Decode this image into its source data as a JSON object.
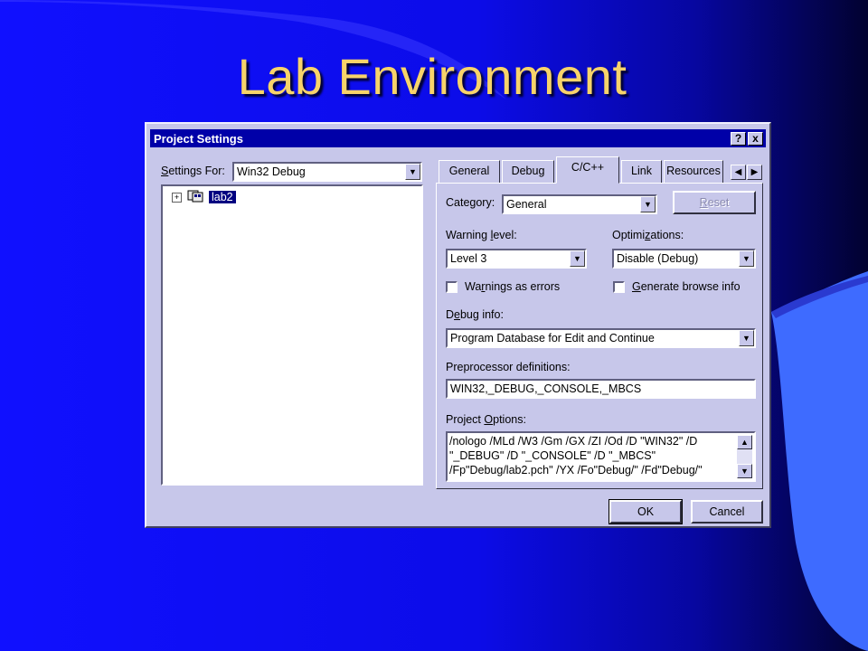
{
  "slide": {
    "title": "Lab Environment"
  },
  "colors": {
    "background": "#1010ff",
    "title": "#f7d36a",
    "dialog": "#c7c7ea",
    "titlebar": "#0000a8"
  },
  "dialog": {
    "title": "Project Settings",
    "help_button": "?",
    "close_button": "x",
    "settings_for": {
      "label_pre": "",
      "label_u": "S",
      "label_post": "ettings For:",
      "value": "Win32 Debug"
    },
    "tree": {
      "expander": "+",
      "node_icon": "project-icon",
      "node_label": "lab2"
    },
    "tabs": [
      {
        "label": "General"
      },
      {
        "label": "Debug"
      },
      {
        "label": "C/C++"
      },
      {
        "label": "Link"
      },
      {
        "label": "Resources"
      }
    ],
    "tab_scroll": {
      "left": "◀",
      "right": "▶"
    },
    "category": {
      "label_pre": "Cate",
      "label_u": "g",
      "label_post": "ory:",
      "value": "General"
    },
    "reset_button": {
      "label_u": "R",
      "label_post": "eset"
    },
    "warning_level": {
      "label_pre": "Warning ",
      "label_u": "l",
      "label_post": "evel:",
      "value": "Level 3"
    },
    "optimizations": {
      "label_pre": "Optimi",
      "label_u": "z",
      "label_post": "ations:",
      "value": "Disable (Debug)"
    },
    "warnings_as_errors": {
      "label_pre": "Wa",
      "label_u": "r",
      "label_post": "nings as errors",
      "checked": false
    },
    "generate_browse": {
      "label_pre": "",
      "label_u": "G",
      "label_post": "enerate browse info",
      "checked": false
    },
    "debug_info": {
      "label_pre": "D",
      "label_u": "e",
      "label_post": "bug info:",
      "value": "Program Database for Edit and Continue"
    },
    "preprocessor": {
      "label_pre": "Preprocessor definitions:",
      "value": "WIN32,_DEBUG,_CONSOLE,_MBCS"
    },
    "project_options": {
      "label_pre": "Project ",
      "label_u": "O",
      "label_post": "ptions:",
      "lines": [
        "/nologo /MLd /W3 /Gm /GX /ZI /Od /D \"WIN32\" /D",
        "\"_DEBUG\" /D \"_CONSOLE\" /D \"_MBCS\"",
        "/Fp\"Debug/lab2.pch\" /YX /Fo\"Debug/\" /Fd\"Debug/\""
      ]
    },
    "ok_button": "OK",
    "cancel_button": "Cancel",
    "dropdown_arrow": "▼",
    "scroll_up": "▲",
    "scroll_down": "▼"
  }
}
